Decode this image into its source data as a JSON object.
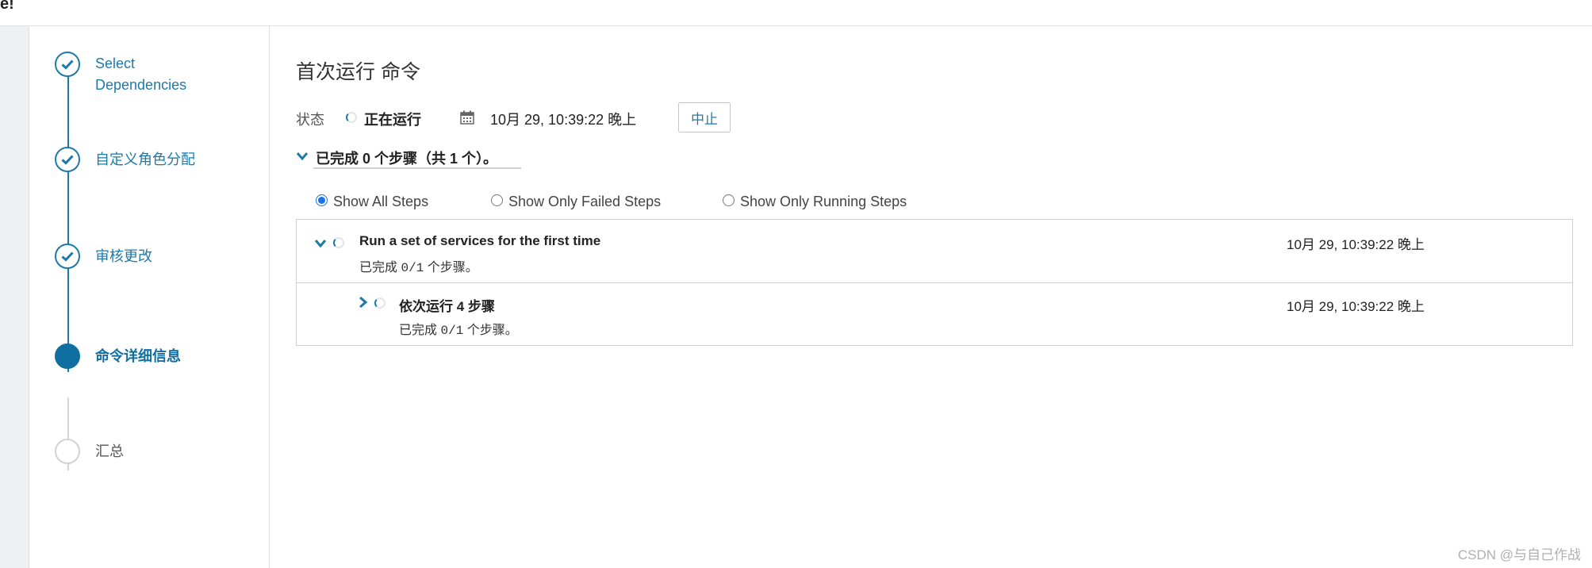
{
  "topbar": {
    "fragment": "e!"
  },
  "wizard": {
    "steps": [
      {
        "label_line1": "Select",
        "label_line2": "Dependencies",
        "state": "done"
      },
      {
        "label": "自定义角色分配",
        "state": "done"
      },
      {
        "label": "审核更改",
        "state": "done"
      },
      {
        "label": "命令详细信息",
        "state": "active"
      },
      {
        "label": "汇总",
        "state": "todo"
      }
    ]
  },
  "command": {
    "title": "首次运行 命令",
    "status_label": "状态",
    "status_value": "正在运行",
    "start_time": "10月 29, 10:39:22 晚上",
    "abort_label": "中止",
    "summary": "已完成 0 个步骤（共 1 个）。"
  },
  "filters": {
    "options": [
      "Show All Steps",
      "Show Only Failed Steps",
      "Show Only Running Steps"
    ],
    "selected": "Show All Steps"
  },
  "steps": [
    {
      "name": "Run a set of services for the first time",
      "progress_prefix": "已完成",
      "progress": "0/1",
      "progress_suffix": "个步骤。",
      "time": "10月 29, 10:39:22 晚上"
    },
    {
      "name": "依次运行 4 步骤",
      "progress_prefix": "已完成",
      "progress": "0/1",
      "progress_suffix": "个步骤。",
      "time": "10月 29, 10:39:22 晚上"
    }
  ],
  "watermark": "CSDN @与自己作战",
  "colors": {
    "accent": "#1d7aa8",
    "active": "#0f6fa0",
    "radio": "#1a73e8"
  }
}
